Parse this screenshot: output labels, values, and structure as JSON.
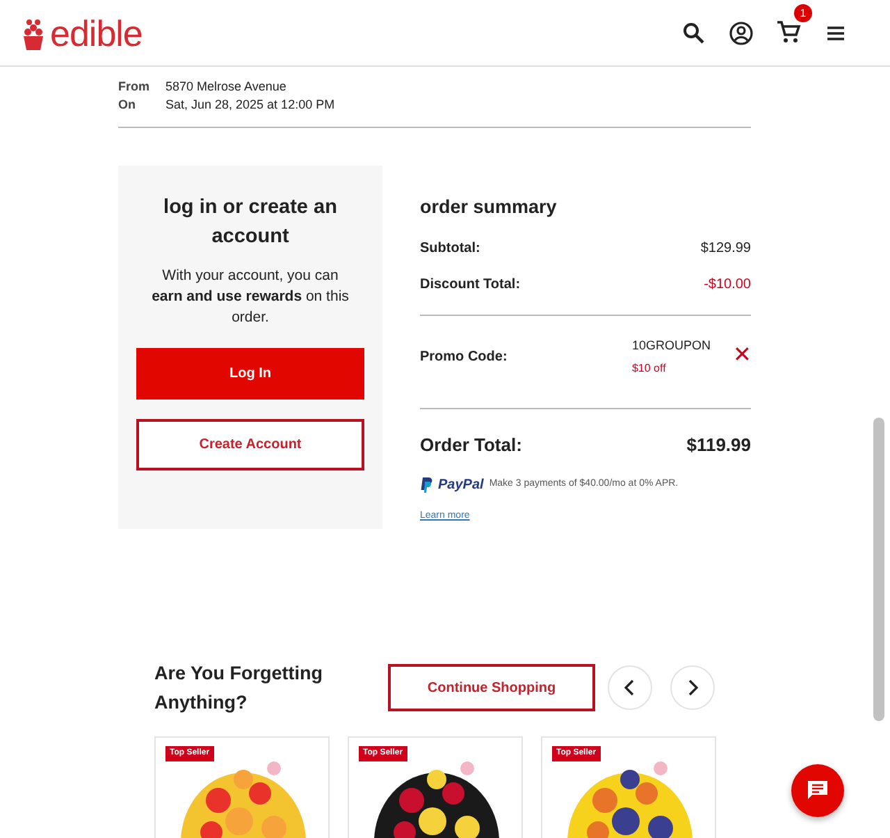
{
  "header": {
    "logo": "edible",
    "cart_count": "1"
  },
  "delivery": [
    {
      "label": "From",
      "value": "5870 Melrose Avenue"
    },
    {
      "label": "On",
      "value": "Sat, Jun 28, 2025 at 12:00 PM"
    }
  ],
  "account": {
    "title": "log in or create an account",
    "text": "With your account, you can **earn and use rewards** on this order.",
    "login": "Log In",
    "create": "Create Account"
  },
  "summary": {
    "title": "order summary",
    "lines": [
      {
        "label": "Subtotal:",
        "value": "$129.99",
        "kind": "plain"
      },
      {
        "label": "Discount Total:",
        "value": "-$10.00",
        "kind": "discount"
      }
    ],
    "promo": {
      "label": "Promo Code:",
      "code": "10GROUPON",
      "note": "$10 off",
      "remove": "✕"
    },
    "total": {
      "label": "Order Total:",
      "value": "$119.99"
    },
    "paypal": {
      "brand": "PayPal",
      "text": "Make 3 payments of $40.00/mo at 0% APR.",
      "link": "Learn more"
    }
  },
  "forgetting": {
    "title": "Are You Forgetting Anything?",
    "button": "Continue Shopping",
    "products": [
      {
        "badge": "Top Seller",
        "kind": "picture"
      },
      {
        "badge": "Top Seller",
        "kind": "picture"
      },
      {
        "badge": "Top Seller",
        "kind": "picture"
      }
    ]
  }
}
